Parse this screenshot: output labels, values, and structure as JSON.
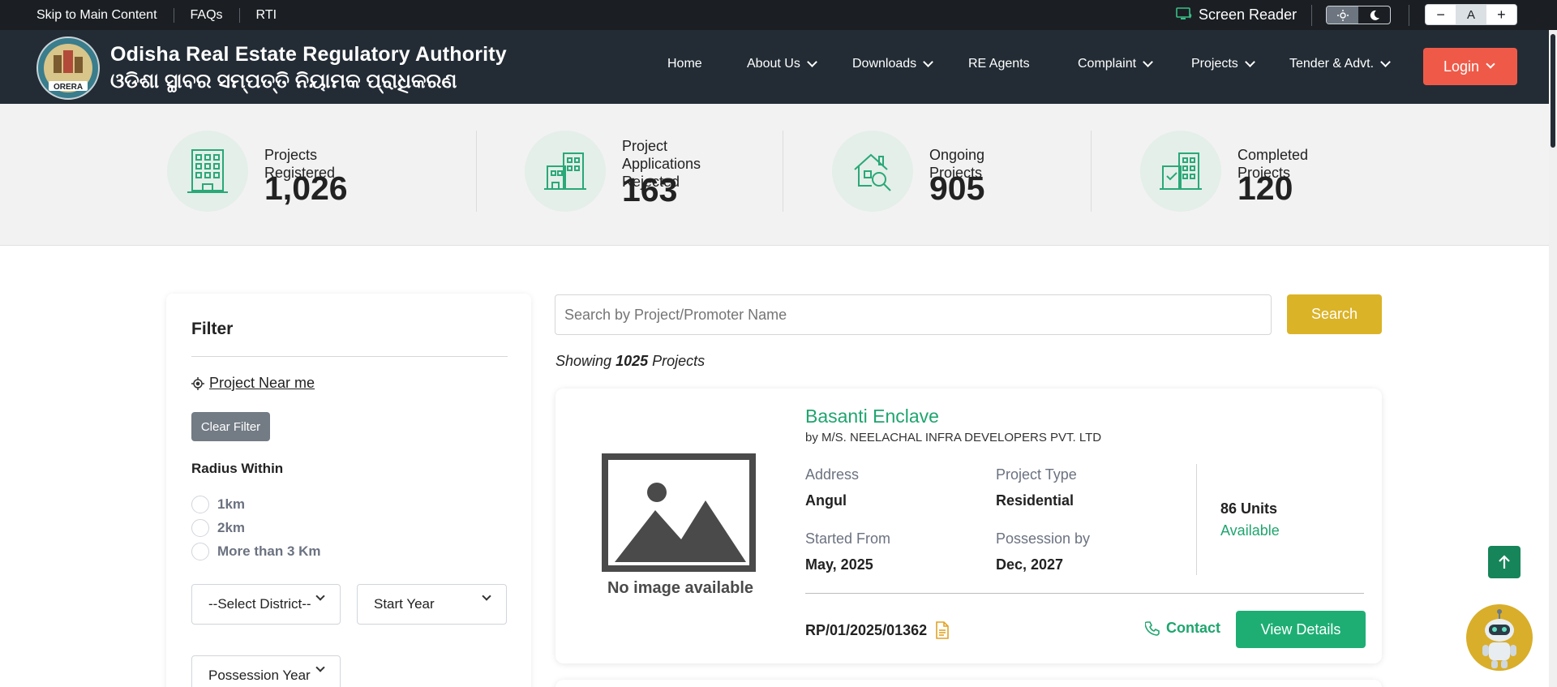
{
  "topbar": {
    "links": [
      "Skip to Main Content",
      "FAQs",
      "RTI"
    ],
    "screen_reader": "Screen Reader",
    "font_small": "−",
    "font_normal": "A",
    "font_large": "+"
  },
  "header": {
    "brand_en": "Odisha Real Estate Regulatory Authority",
    "brand_or": "ଓଡିଶା ସ୍ଥାବର ସମ୍ପତ୍ତି ନିୟାମକ ପ୍ରାଧିକରଣ",
    "logo_text": "ORERA",
    "nav": [
      {
        "label": "Home",
        "dropdown": false
      },
      {
        "label": "About Us",
        "dropdown": true
      },
      {
        "label": "Downloads",
        "dropdown": true
      },
      {
        "label": "RE Agents",
        "dropdown": false
      },
      {
        "label": "Complaint",
        "dropdown": true
      },
      {
        "label": "Projects",
        "dropdown": true
      },
      {
        "label": "Tender & Advt.",
        "dropdown": true
      }
    ],
    "login": "Login"
  },
  "stats": [
    {
      "label": "Projects Registered",
      "value": "1,026",
      "icon": "building-icon"
    },
    {
      "label": "Project Applications Rejected",
      "value": "163",
      "icon": "rejected-buildings-icon"
    },
    {
      "label": "Ongoing Projects",
      "value": "905",
      "icon": "house-search-icon"
    },
    {
      "label": "Completed Projects",
      "value": "120",
      "icon": "completed-buildings-icon"
    }
  ],
  "filter": {
    "title": "Filter",
    "near_me": "Project Near me",
    "clear": "Clear Filter",
    "radius_label": "Radius Within",
    "radius_options": [
      "1km",
      "2km",
      "More than 3 Km"
    ],
    "district": "--Select District--",
    "start_year": "Start Year",
    "possession_year": "Possession Year"
  },
  "search": {
    "placeholder": "Search by Project/Promoter Name",
    "button": "Search"
  },
  "results": {
    "showing_prefix": "Showing",
    "count": "1025",
    "showing_suffix": "Projects"
  },
  "project": {
    "name": "Basanti Enclave",
    "promoter": "by M/S. NEELACHAL INFRA DEVELOPERS PVT. LTD",
    "no_image": "No image available",
    "address_label": "Address",
    "address": "Angul",
    "type_label": "Project Type",
    "type": "Residential",
    "started_label": "Started From",
    "started": "May, 2025",
    "possession_label": "Possession by",
    "possession": "Dec, 2027",
    "units": "86 Units",
    "availability": "Available",
    "reg_no": "RP/01/2025/01362",
    "contact": "Contact",
    "view_details": "View Details"
  },
  "colors": {
    "green": "#1fa56e",
    "gold": "#dbb327",
    "login_red": "#ef5a48",
    "header_dark": "#232c35"
  }
}
